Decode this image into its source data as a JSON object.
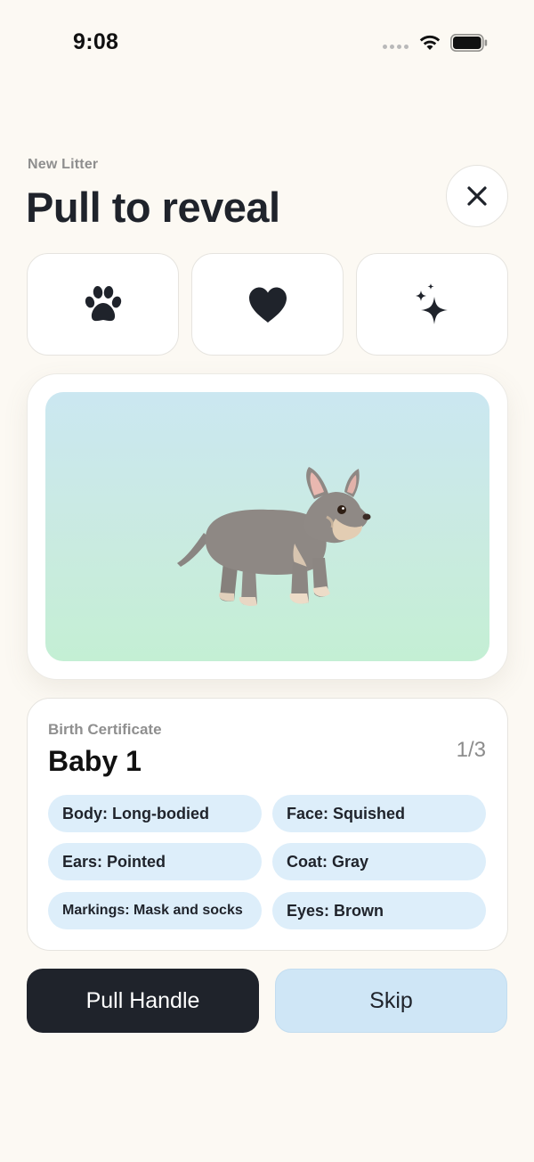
{
  "status_bar": {
    "time": "9:08"
  },
  "header": {
    "eyebrow": "New Litter",
    "title": "Pull to reveal"
  },
  "tiles": [
    {
      "icon": "paw-icon"
    },
    {
      "icon": "heart-icon"
    },
    {
      "icon": "sparkles-icon"
    }
  ],
  "reveal": {
    "background_top": "#CBE7F1",
    "background_bottom": "#C4EFD4"
  },
  "certificate": {
    "label": "Birth Certificate",
    "name": "Baby 1",
    "count": "1/3",
    "traits": [
      "Body: Long-bodied",
      "Face: Squished",
      "Ears: Pointed",
      "Coat: Gray",
      "Markings: Mask and socks",
      "Eyes: Brown"
    ]
  },
  "actions": {
    "pull_label": "Pull Handle",
    "skip_label": "Skip"
  },
  "colors": {
    "background": "#FCF9F3",
    "ink": "#1F232B",
    "chip": "#DDEEFA",
    "secondary_button": "#CFE6F6"
  }
}
